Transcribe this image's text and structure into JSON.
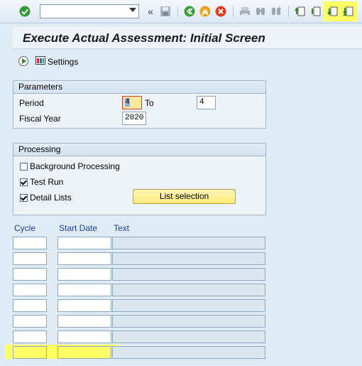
{
  "window": {
    "title": "Execute Actual Assessment: Initial Screen"
  },
  "toolbar": {
    "command_field_value": "",
    "icons": [
      "enter-icon",
      "save-icon",
      "back-icon",
      "exit-icon",
      "cancel-icon",
      "print-icon",
      "find-icon",
      "find-next-icon",
      "first-page-icon",
      "previous-page-icon",
      "next-page-icon",
      "last-page-icon"
    ]
  },
  "app_toolbar": {
    "settings_label": "Settings"
  },
  "parameters": {
    "heading": "Parameters",
    "period_label": "Period",
    "period_from": "4",
    "to_label": "To",
    "period_to": "4",
    "fiscal_year_label": "Fiscal Year",
    "fiscal_year": "2020"
  },
  "processing": {
    "heading": "Processing",
    "background_label": "Background Processing",
    "background_checked": false,
    "test_run_label": "Test Run",
    "test_run_checked": true,
    "detail_lists_label": "Detail Lists",
    "detail_lists_checked": true,
    "list_selection_label": "List selection"
  },
  "table": {
    "columns": [
      "Cycle",
      "Start Date",
      "Text"
    ],
    "rows": [
      {
        "cycle": "",
        "start_date": "",
        "text": ""
      },
      {
        "cycle": "",
        "start_date": "",
        "text": ""
      },
      {
        "cycle": "",
        "start_date": "",
        "text": ""
      },
      {
        "cycle": "",
        "start_date": "",
        "text": ""
      },
      {
        "cycle": "",
        "start_date": "",
        "text": ""
      },
      {
        "cycle": "",
        "start_date": "",
        "text": ""
      },
      {
        "cycle": "",
        "start_date": "",
        "text": ""
      },
      {
        "cycle": "",
        "start_date": "",
        "text": ""
      }
    ]
  },
  "colors": {
    "highlight": "#ffff66",
    "header_text": "#1e3ea8",
    "button_yellow": "#ffe87a"
  }
}
